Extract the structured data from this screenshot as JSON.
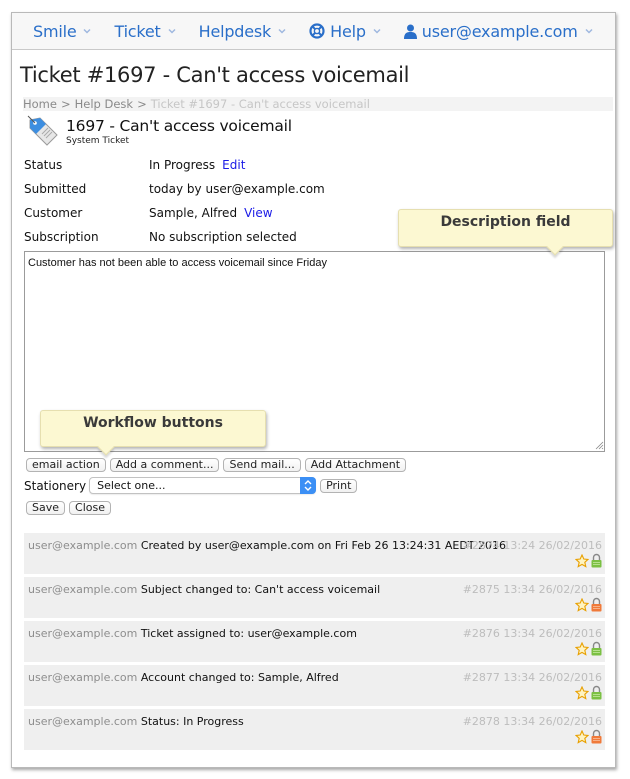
{
  "nav": {
    "items": [
      {
        "label": "Smile",
        "icon": null
      },
      {
        "label": "Ticket",
        "icon": null
      },
      {
        "label": "Helpdesk",
        "icon": null
      },
      {
        "label": "Help",
        "icon": "lifebuoy-icon"
      },
      {
        "label": "user@example.com",
        "icon": "user-icon"
      }
    ],
    "color": "#2a6fc9"
  },
  "page": {
    "title": "Ticket #1697 - Can't access voicemail"
  },
  "breadcrumb": {
    "items": [
      "Home",
      "Help Desk",
      "Ticket #1697 - Can't access voicemail"
    ],
    "separator": ">"
  },
  "ticket": {
    "heading": "1697 - Can't access voicemail",
    "type": "System Ticket",
    "icon": "tag-icon",
    "properties": [
      {
        "label": "Status",
        "value": "In Progress",
        "link": "Edit"
      },
      {
        "label": "Submitted",
        "value": "today by user@example.com",
        "link": null
      },
      {
        "label": "Customer",
        "value": "Sample, Alfred",
        "link": "View"
      },
      {
        "label": "Subscription",
        "value": "No subscription selected",
        "link": null
      }
    ],
    "description": "Customer has not been able to access voicemail since Friday"
  },
  "callouts": {
    "description": "Description field",
    "workflow": "Workflow buttons"
  },
  "workflow_buttons": [
    "email action",
    "Add a comment...",
    "Send mail...",
    "Add Attachment"
  ],
  "stationery": {
    "label": "Stationery",
    "selected": "Select one...",
    "print_label": "Print"
  },
  "actions": {
    "save_label": "Save",
    "close_label": "Close"
  },
  "history": [
    {
      "user": "user@example.com",
      "message": "Created by user@example.com on Fri Feb 26 13:24:31 AEDT 2016",
      "meta": "#2874 13:24 26/02/2016",
      "lock": "locked-green"
    },
    {
      "user": "user@example.com",
      "message": "Subject changed to: Can't access voicemail",
      "meta": "#2875 13:34 26/02/2016",
      "lock": "unlocked-orange"
    },
    {
      "user": "user@example.com",
      "message": "Ticket assigned to: user@example.com",
      "meta": "#2876 13:34 26/02/2016",
      "lock": "locked-green"
    },
    {
      "user": "user@example.com",
      "message": "Account changed to: Sample, Alfred",
      "meta": "#2877 13:34 26/02/2016",
      "lock": "locked-green"
    },
    {
      "user": "user@example.com",
      "message": "Status: In Progress",
      "meta": "#2878 13:34 26/02/2016",
      "lock": "unlocked-orange"
    }
  ],
  "colors": {
    "link": "#1a1ae6",
    "lock_green": "#7bc043",
    "lock_orange": "#f07a3a",
    "star": "#f5b800"
  }
}
